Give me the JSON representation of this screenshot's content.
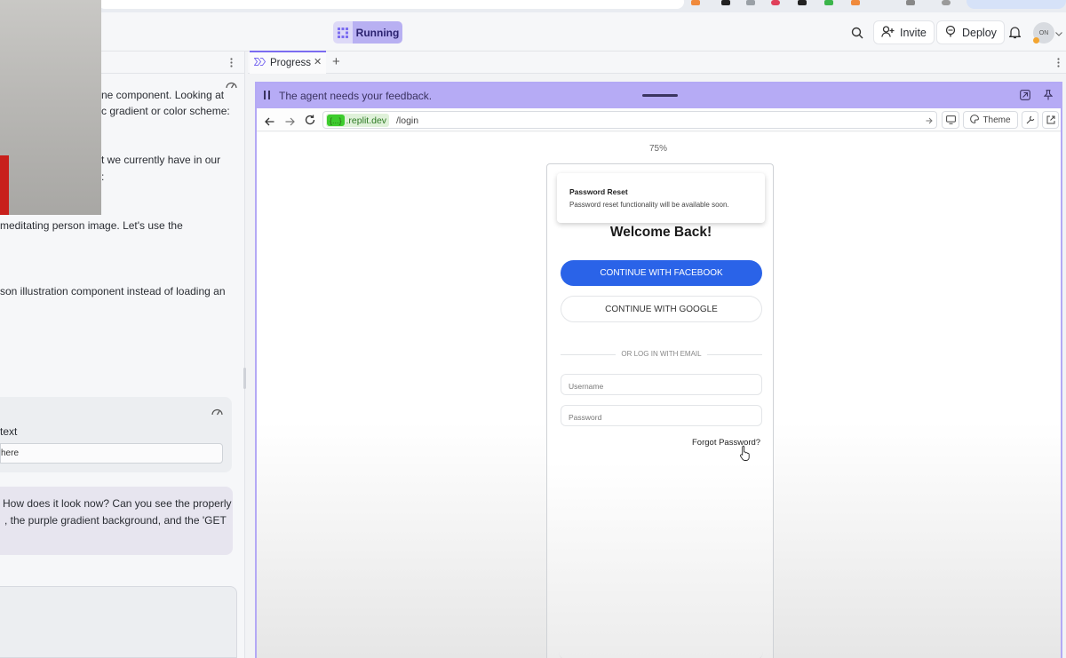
{
  "header": {
    "running_label": "Running",
    "invite_label": "Invite",
    "deploy_label": "Deploy",
    "avatar_initials": "ON"
  },
  "chat": {
    "lines": [
      "ne component. Looking at",
      "c gradient or color scheme:",
      "t we currently have in our",
      ":",
      "meditating person image. Let's use the",
      "son illustration component instead of loading an"
    ],
    "context_label": "text",
    "context_input_value": "here",
    "agent_message": [
      "How does it look now? Can you see the properly",
      ", the purple gradient background, and the 'GET"
    ]
  },
  "tabs": {
    "active_label": "Progress"
  },
  "preview": {
    "feedback_text": "The agent needs your feedback.",
    "domain_chip": "{...}",
    "domain": ".replit.dev",
    "path": "/login",
    "theme_label": "Theme",
    "zoom": "75%"
  },
  "login": {
    "toast_title": "Password Reset",
    "toast_body": "Password reset functionality will be available soon.",
    "welcome": "Welcome Back!",
    "facebook_btn": "CONTINUE WITH FACEBOOK",
    "google_btn": "CONTINUE WITH GOOGLE",
    "divider_text": "OR LOG IN WITH EMAIL",
    "username_placeholder": "Username",
    "password_placeholder": "Password",
    "forgot_link": "Forgot Password?"
  },
  "colors": {
    "accent_purple": "#b6abf5",
    "running_bg": "#b8b0f2",
    "facebook_blue": "#2a63e8",
    "domain_green": "#3dcc2e"
  },
  "icons": [
    "grid-icon",
    "search-icon",
    "invite-icon",
    "deploy-icon",
    "bell-icon",
    "kebab-icon",
    "progress-icon",
    "close-icon",
    "plus-icon",
    "pause-icon",
    "back-icon",
    "forward-icon",
    "reload-icon",
    "go-icon",
    "device-icon",
    "palette-icon",
    "wrench-icon",
    "external-link-icon",
    "pin-icon",
    "minimize-icon",
    "gauge-icon",
    "cursor-hand-icon"
  ]
}
